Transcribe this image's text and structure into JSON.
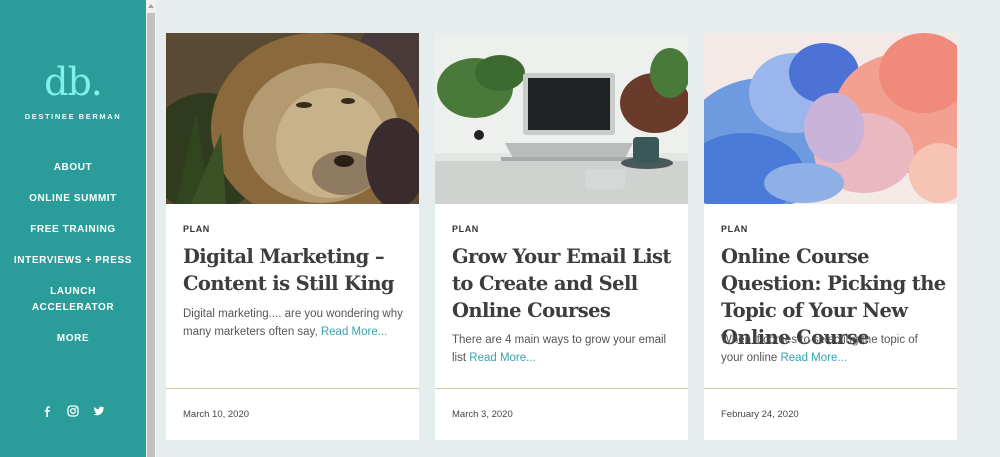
{
  "sidebar": {
    "logo_mark": "db.",
    "logo_name": "DESTINEE BERMAN",
    "nav": [
      "ABOUT",
      "ONLINE SUMMIT",
      "FREE TRAINING",
      "INTERVIEWS + PRESS",
      "LAUNCH",
      "ACCELERATOR",
      "MORE"
    ],
    "social_icons": [
      "facebook-icon",
      "instagram-icon",
      "twitter-icon"
    ],
    "background_color": "#2a9d9b",
    "logo_color": "#7ff0ea"
  },
  "posts": [
    {
      "category": "PLAN",
      "title": "Digital Marketing – Content is Still King",
      "excerpt": "Digital marketing.... are you wondering why many marketers often say,",
      "read_more": "Read More...",
      "date": "March 10, 2020",
      "image": "lion-photo"
    },
    {
      "category": "PLAN",
      "title": "Grow Your Email List to Create and Sell Online Courses",
      "excerpt": "There are 4 main ways to grow your email list",
      "read_more": "Read More...",
      "date": "March 3, 2020",
      "image": "laptop-desk-photo"
    },
    {
      "category": "PLAN",
      "title": "Online Course Question: Picking the Topic of Your New Online Course",
      "excerpt": "When it comes to selecting the topic of your online",
      "read_more": "Read More...",
      "date": "February 24, 2020",
      "image": "color-smoke-photo"
    }
  ],
  "colors": {
    "link": "#3aa2b0",
    "page_background": "#e6edee",
    "divider": "#c9cf9c"
  }
}
